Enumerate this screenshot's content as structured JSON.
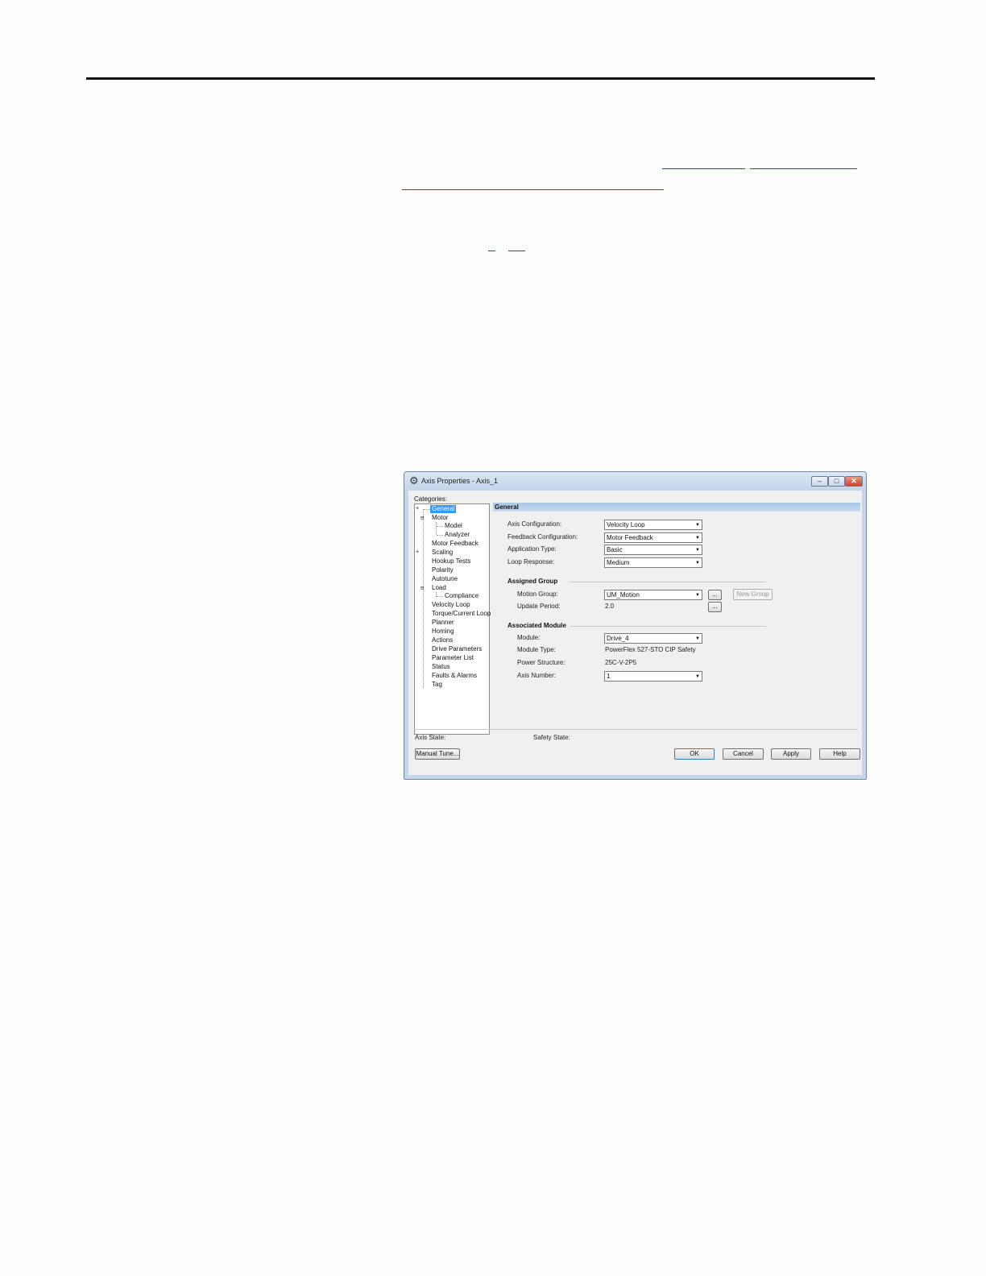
{
  "window": {
    "title": "Axis Properties - Axis_1",
    "min_label": "–",
    "max_label": "□",
    "close_label": "✕"
  },
  "categories": {
    "label": "Categories:",
    "items": [
      {
        "label": "General",
        "selected": true
      },
      {
        "label": "Motor"
      },
      {
        "label": "Model"
      },
      {
        "label": "Analyzer"
      },
      {
        "label": "Motor Feedback"
      },
      {
        "label": "Scaling"
      },
      {
        "label": "Hookup Tests"
      },
      {
        "label": "Polarity"
      },
      {
        "label": "Autotune"
      },
      {
        "label": "Load"
      },
      {
        "label": "Compliance"
      },
      {
        "label": "Velocity Loop"
      },
      {
        "label": "Torque/Current Loop"
      },
      {
        "label": "Planner"
      },
      {
        "label": "Homing"
      },
      {
        "label": "Actions"
      },
      {
        "label": "Drive Parameters"
      },
      {
        "label": "Parameter List"
      },
      {
        "label": "Status"
      },
      {
        "label": "Faults & Alarms"
      },
      {
        "label": "Tag"
      }
    ]
  },
  "general": {
    "header": "General",
    "axis_configuration": {
      "label": "Axis Configuration:",
      "value": "Velocity Loop"
    },
    "feedback_configuration": {
      "label": "Feedback Configuration:",
      "value": "Motor Feedback"
    },
    "application_type": {
      "label": "Application Type:",
      "value": "Basic"
    },
    "loop_response": {
      "label": "Loop Response:",
      "value": "Medium"
    }
  },
  "assigned_group": {
    "title": "Assigned Group",
    "motion_group": {
      "label": "Motion Group:",
      "value": "UM_Motion"
    },
    "update_period": {
      "label": "Update Period:",
      "value": "2.0"
    },
    "browse_label": "...",
    "new_group_label": "New Group"
  },
  "associated_module": {
    "title": "Associated Module",
    "module": {
      "label": "Module:",
      "value": "Drive_4"
    },
    "module_type": {
      "label": "Module Type:",
      "value": "PowerFlex 527-STO CIP Safety"
    },
    "power_structure": {
      "label": "Power Structure:",
      "value": "25C-V-2P5"
    },
    "axis_number": {
      "label": "Axis Number:",
      "value": "1"
    }
  },
  "status": {
    "axis_state_label": "Axis State:",
    "safety_state_label": "Safety State:"
  },
  "buttons": {
    "manual_tune": "Manual Tune...",
    "ok": "OK",
    "cancel": "Cancel",
    "apply": "Apply",
    "help": "Help"
  }
}
